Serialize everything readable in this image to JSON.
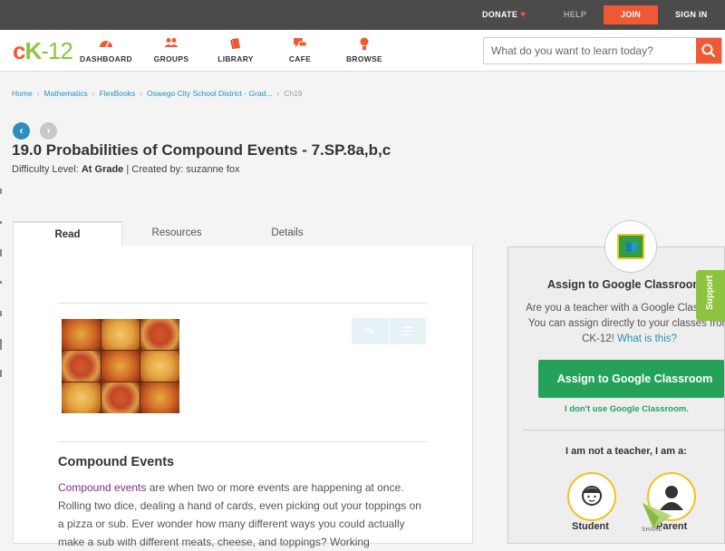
{
  "topbar": {
    "donate_label": "DONATE",
    "heart_icon": "heart-icon",
    "help_label": "HELP",
    "join_label": "JOIN",
    "signin_label": "SIGN IN",
    "join_color": "#ef5a34"
  },
  "logo": {
    "c": "c",
    "k": "K",
    "rest": "-12"
  },
  "nav": {
    "items": [
      {
        "label": "DASHBOARD",
        "icon": "dashboard-icon"
      },
      {
        "label": "GROUPS",
        "icon": "groups-icon"
      },
      {
        "label": "LIBRARY",
        "icon": "library-icon"
      },
      {
        "label": "CAFE",
        "icon": "cafe-icon"
      },
      {
        "label": "BROWSE",
        "icon": "browse-icon"
      }
    ],
    "search_placeholder": "What do you want to learn today?",
    "accent_color": "#ef5a34"
  },
  "breadcrumb": {
    "items": [
      "Home",
      "Mathematics",
      "FlexBooks",
      "Oswego City School District - Grad...",
      "Ch19"
    ]
  },
  "header": {
    "title": "19.0 Probabilities of Compound Events - 7.SP.8a,b,c",
    "difficulty_prefix": "Difficulty Level:",
    "difficulty_value": "At Grade",
    "created_by": "| Created by: suzanne fox"
  },
  "tabs": [
    {
      "label": "Read"
    },
    {
      "label": "Resources"
    },
    {
      "label": "Details"
    }
  ],
  "content": {
    "section_title": "Compound Events",
    "link_text": "Compound events",
    "paragraph": " are when two or more events are happening at once. Rolling two dice, dealing a hand of cards, even picking out your toppings on a pizza or sub.   Ever wonder how many different ways you could actually make a sub with different meats, cheese, and toppings?  Working"
  },
  "google_classroom": {
    "title": "Assign to Google Classroom",
    "description": "Are you a teacher with a Google Classroom? You can assign directly to your classes from CK-12!",
    "what_is_this": "What is this?",
    "button_label": "Assign to Google Classroom",
    "no_use_label": "I don't use Google Classroom.",
    "not_teacher_label": "I am not a teacher, I am a:",
    "roles": [
      {
        "label": "Student"
      },
      {
        "label": "Parent"
      }
    ],
    "share_label": "SHARE",
    "button_color": "#25a25a"
  },
  "support_label": "Support"
}
